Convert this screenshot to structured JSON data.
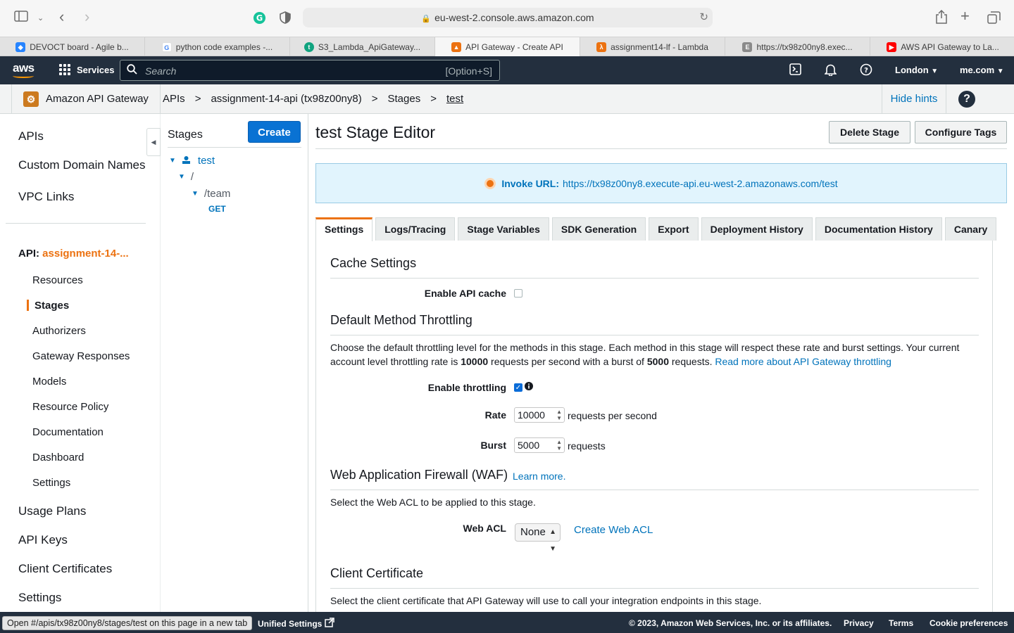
{
  "browser": {
    "url": "eu-west-2.console.aws.amazon.com",
    "tabs": [
      {
        "label": "DEVOCT board - Agile b...",
        "icon": "jira-icon",
        "color": "#2684ff"
      },
      {
        "label": "python code examples -...",
        "icon": "google-icon",
        "color": "#4285f4"
      },
      {
        "label": "S3_Lambda_ApiGateway...",
        "icon": "notion-icon",
        "color": "#10a37f"
      },
      {
        "label": "API Gateway - Create API",
        "icon": "aws-icon",
        "color": "#ec7211"
      },
      {
        "label": "assignment14-lf - Lambda",
        "icon": "lambda-icon",
        "color": "#ec7211"
      },
      {
        "label": "https://tx98z00ny8.exec...",
        "icon": "letter-e-icon",
        "color": "#8a8a8a"
      },
      {
        "label": "AWS API Gateway to La...",
        "icon": "youtube-icon",
        "color": "#ff0000"
      }
    ]
  },
  "aws_nav": {
    "logo": "aws",
    "services": "Services",
    "search_placeholder": "Search",
    "search_shortcut": "[Option+S]",
    "region": "London",
    "account": "me.com"
  },
  "breadcrumb": {
    "service": "Amazon API Gateway",
    "items": [
      "APIs",
      "assignment-14-api (tx98z00ny8)",
      "Stages",
      "test"
    ],
    "separator": ">",
    "hide_hints": "Hide hints",
    "help": "?"
  },
  "leftnav": {
    "top_items": [
      "APIs",
      "Custom Domain Names",
      "VPC Links"
    ],
    "api_prefix": "API:",
    "api_name": "assignment-14-...",
    "api_items": [
      "Resources",
      "Stages",
      "Authorizers",
      "Gateway Responses",
      "Models",
      "Resource Policy",
      "Documentation",
      "Dashboard",
      "Settings"
    ],
    "bottom_items": [
      "Usage Plans",
      "API Keys",
      "Client Certificates",
      "Settings"
    ]
  },
  "stages_panel": {
    "title": "Stages",
    "create": "Create",
    "tree": {
      "stage": "test",
      "root": "/",
      "resource": "/team",
      "method": "GET"
    }
  },
  "main": {
    "title": "test Stage Editor",
    "delete_stage": "Delete Stage",
    "configure_tags": "Configure Tags",
    "invoke_label": "Invoke URL:",
    "invoke_url": "https://tx98z00ny8.execute-api.eu-west-2.amazonaws.com/test",
    "tabs": [
      "Settings",
      "Logs/Tracing",
      "Stage Variables",
      "SDK Generation",
      "Export",
      "Deployment History",
      "Documentation History",
      "Canary"
    ],
    "cache": {
      "heading": "Cache Settings",
      "enable_label": "Enable API cache",
      "enabled": false
    },
    "throttling": {
      "heading": "Default Method Throttling",
      "desc_1": "Choose the default throttling level for the methods in this stage. Each method in this stage will respect these rate and burst settings. Your current",
      "desc_2a": "account level throttling rate is ",
      "rate_limit": "10000",
      "desc_2b": " requests per second with a burst of ",
      "burst_limit": "5000",
      "desc_2c": " requests. ",
      "read_more": "Read more about API Gateway throttling",
      "enable_label": "Enable throttling",
      "enabled": true,
      "rate_label": "Rate",
      "rate_value": "10000",
      "rate_unit": "requests per second",
      "burst_label": "Burst",
      "burst_value": "5000",
      "burst_unit": "requests"
    },
    "waf": {
      "heading": "Web Application Firewall (WAF)",
      "learn_more": "Learn more.",
      "desc": "Select the Web ACL to be applied to this stage.",
      "acl_label": "Web ACL",
      "acl_value": "None",
      "create_acl": "Create Web ACL"
    },
    "client_cert": {
      "heading": "Client Certificate",
      "desc": "Select the client certificate that API Gateway will use to call your integration endpoints in this stage."
    }
  },
  "footer": {
    "status_tip": "Open #/apis/tx98z00ny8/stages/test on this page in a new tab",
    "unified_settings": "Unified Settings",
    "copyright": "© 2023, Amazon Web Services, Inc. or its affiliates.",
    "privacy": "Privacy",
    "terms": "Terms",
    "cookies": "Cookie preferences"
  }
}
